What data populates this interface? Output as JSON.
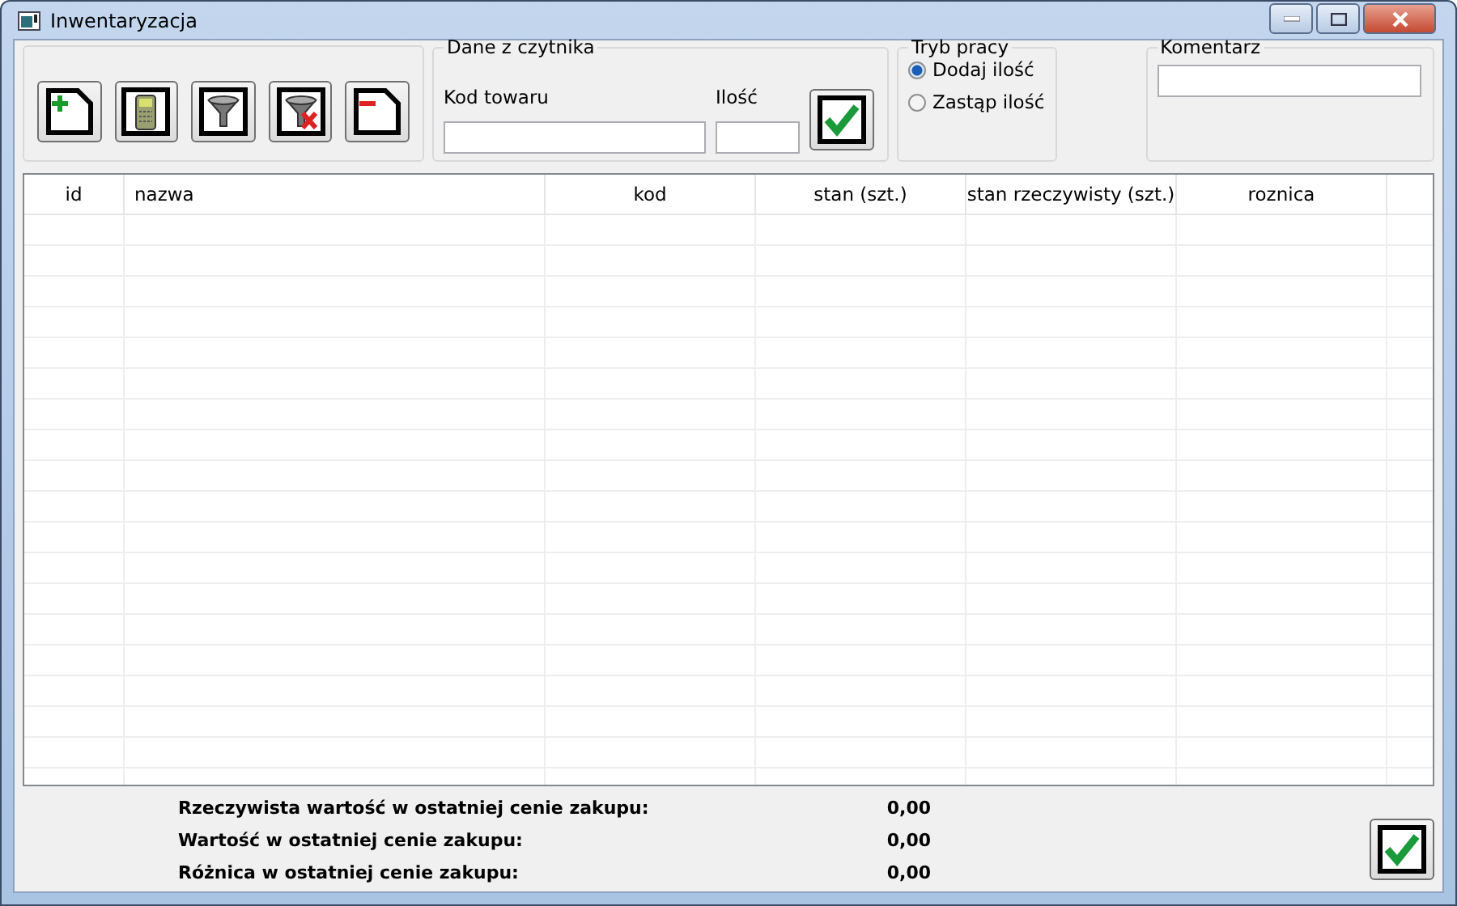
{
  "window": {
    "title": "Inwentaryzacja"
  },
  "toolbar": [
    {
      "kind": "add"
    },
    {
      "kind": "reader"
    },
    {
      "kind": "filter"
    },
    {
      "kind": "filter-clear"
    },
    {
      "kind": "remove"
    }
  ],
  "reader": {
    "title": "Dane z czytnika",
    "code_label": "Kod towaru",
    "qty_label": "Ilość"
  },
  "mode": {
    "title": "Tryb pracy",
    "options": [
      {
        "label": "Dodaj ilość",
        "selected": true
      },
      {
        "label": "Zastąp ilość",
        "selected": false
      }
    ]
  },
  "comment": {
    "title": "Komentarz"
  },
  "table": {
    "columns": [
      "id",
      "nazwa",
      "kod",
      "stan (szt.)",
      "stan rzeczywisty (szt.)",
      "roznica"
    ]
  },
  "summary": [
    {
      "label": "Rzeczywista wartość w ostatniej cenie zakupu:",
      "value": "0,00"
    },
    {
      "label": "Wartość w ostatniej cenie zakupu:",
      "value": "0,00"
    },
    {
      "label": "Różnica w ostatniej cenie zakupu:",
      "value": "0,00"
    }
  ]
}
